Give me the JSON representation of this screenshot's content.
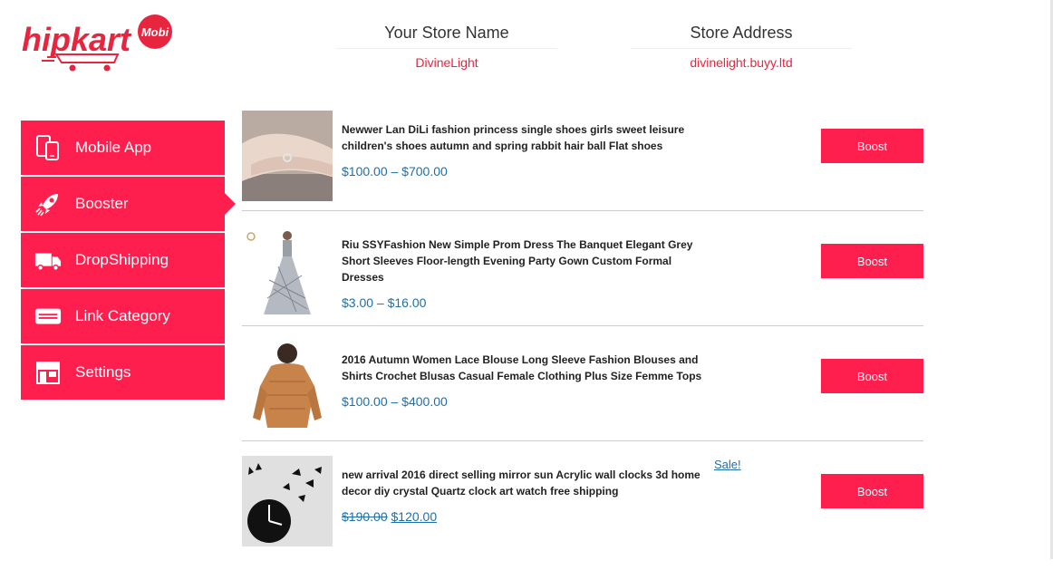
{
  "logo": {
    "text": "hipkart",
    "badge": "Mobi",
    "brand_color": "#e8253f"
  },
  "header": {
    "store_name_label": "Your Store Name",
    "store_name_value": "DivineLight",
    "store_address_label": "Store Address",
    "store_address_value": "divinelight.buyy.ltd"
  },
  "sidebar": {
    "color": "#ff1f4f",
    "items": [
      {
        "label": "Mobile App",
        "icon": "mobile-devices-icon",
        "active": false
      },
      {
        "label": "Booster",
        "icon": "rocket-icon",
        "active": true
      },
      {
        "label": "DropShipping",
        "icon": "truck-icon",
        "active": false
      },
      {
        "label": "Link Category",
        "icon": "card-icon",
        "active": false
      },
      {
        "label": "Settings",
        "icon": "store-icon",
        "active": false
      }
    ]
  },
  "products": [
    {
      "title": "Newwer Lan DiLi fashion princess single shoes girls sweet leisure children's shoes autumn and spring rabbit hair ball Flat shoes",
      "price": "$100.00 – $700.00",
      "boost_label": "Boost"
    },
    {
      "title": "Riu SSYFashion New Simple Prom Dress The Banquet Elegant Grey Short Sleeves Floor-length Evening Party Gown Custom Formal Dresses",
      "price": "$3.00 – $16.00",
      "boost_label": "Boost"
    },
    {
      "title": "2016 Autumn Women Lace Blouse Long Sleeve Fashion Blouses and Shirts Crochet Blusas Casual Female Clothing Plus Size Femme Tops",
      "price": "$100.00 – $400.00",
      "boost_label": "Boost"
    },
    {
      "title": "new arrival 2016 direct selling mirror sun Acrylic wall clocks 3d home decor diy crystal Quartz clock art watch free shipping",
      "old_price": "$190.00",
      "new_price": "$120.00",
      "sale_label": "Sale!",
      "boost_label": "Boost"
    }
  ]
}
